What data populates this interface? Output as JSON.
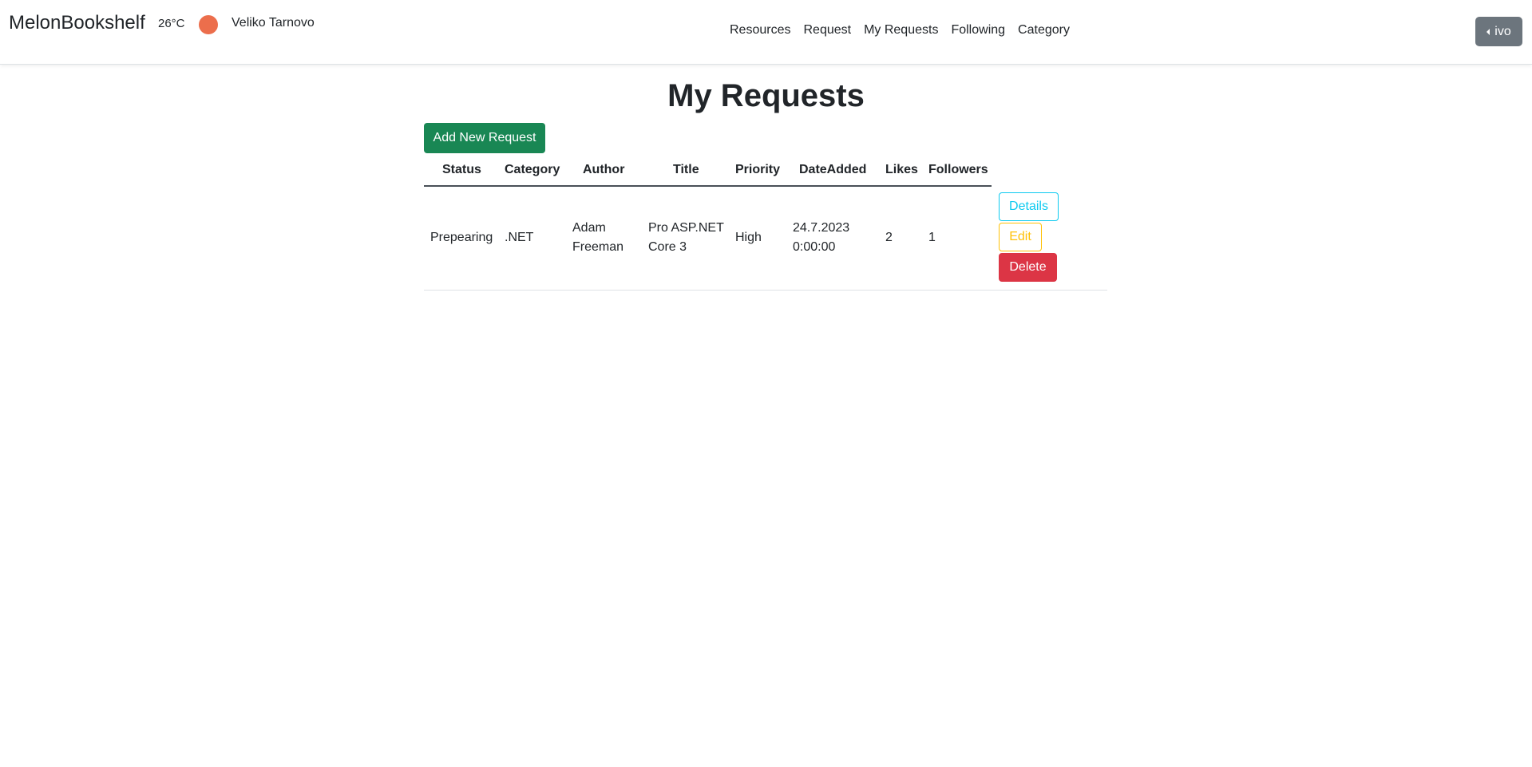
{
  "navbar": {
    "brand": "MelonBookshelf",
    "temperature": "26°C",
    "weather_icon": "sun-dot-icon",
    "weather_color": "#ec6e4c",
    "city": "Veliko Tarnovo",
    "links": [
      "Resources",
      "Request",
      "My Requests",
      "Following",
      "Category"
    ],
    "user": "ivo"
  },
  "page": {
    "title": "My Requests",
    "add_button": "Add New Request"
  },
  "table": {
    "headers": [
      "Status",
      "Category",
      "Author",
      "Title",
      "Priority",
      "DateAdded",
      "Likes",
      "Followers"
    ],
    "rows": [
      {
        "status": "Prepearing",
        "category": ".NET",
        "author_line1": "Adam",
        "author_line2": "Freeman",
        "title_line1": "Pro ASP.NET",
        "title_line2": "Core 3",
        "priority": "High",
        "date_line1": "24.7.2023",
        "date_line2": "0:00:00",
        "likes": "2",
        "followers": "1",
        "actions": {
          "details": "Details",
          "edit": "Edit",
          "delete": "Delete"
        }
      }
    ]
  },
  "colors": {
    "success": "#198754",
    "info": "#0dcaf0",
    "warning": "#ffc107",
    "danger": "#dc3545",
    "secondary": "#6c757d"
  }
}
